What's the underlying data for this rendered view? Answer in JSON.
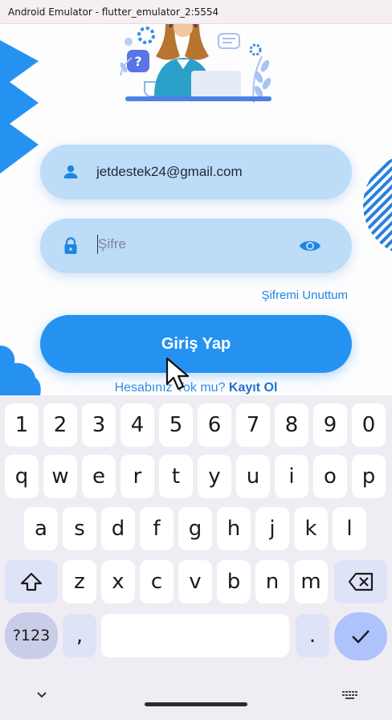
{
  "window": {
    "title": "Android Emulator - flutter_emulator_2:5554"
  },
  "login": {
    "email_value": "jetdestek24@gmail.com",
    "password_placeholder": "Şifre",
    "forgot_label": "Şifremi Unuttum",
    "login_button": "Giriş Yap",
    "signup_prompt": "Hesabınız Yok mu?",
    "signup_link": "Kayıt Ol"
  },
  "colors": {
    "primary": "#2592f2",
    "field_bg": "#bcdcf8",
    "link": "#1d86e3"
  },
  "icons": {
    "email": "person-icon",
    "password": "lock-icon",
    "visibility": "eye-icon"
  },
  "keyboard": {
    "row1": [
      "1",
      "2",
      "3",
      "4",
      "5",
      "6",
      "7",
      "8",
      "9",
      "0"
    ],
    "row2": [
      "q",
      "w",
      "e",
      "r",
      "t",
      "y",
      "u",
      "i",
      "o",
      "p"
    ],
    "row3": [
      "a",
      "s",
      "d",
      "f",
      "g",
      "h",
      "j",
      "k",
      "l"
    ],
    "row4": [
      "z",
      "x",
      "c",
      "v",
      "b",
      "n",
      "m"
    ],
    "symbols_label": "?123",
    "comma": ",",
    "period": "."
  }
}
